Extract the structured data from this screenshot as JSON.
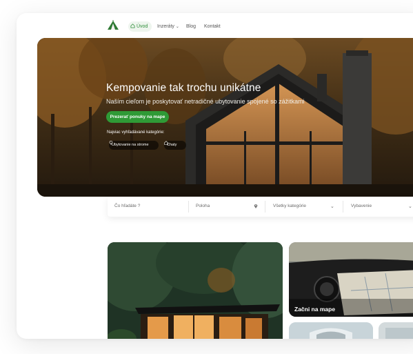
{
  "nav": {
    "home": "Úvod",
    "ads": "Inzeráty",
    "blog": "Blog",
    "contact": "Kontakt"
  },
  "hero": {
    "title": "Kempovanie tak trochu unikátne",
    "subtitle": "Naším cieľom je poskytovať netradičné ubytovanie spojené so zážitkami",
    "cta": "Prezerať ponuky na mape",
    "categories_label": "Najviac vyhľadávané kategórie:",
    "chips": [
      "Ubytovanie na strome",
      "Chaty"
    ]
  },
  "search": {
    "what_placeholder": "Čo hľadáte ?",
    "location_placeholder": "Poloha",
    "category_select": "Všetky kategórie",
    "equipment_select": "Vybavenie"
  },
  "tiles": {
    "map_label": "Začni na mape"
  },
  "colors": {
    "accent_green": "#2f9a36",
    "nav_active_bg": "#eef5ee"
  }
}
